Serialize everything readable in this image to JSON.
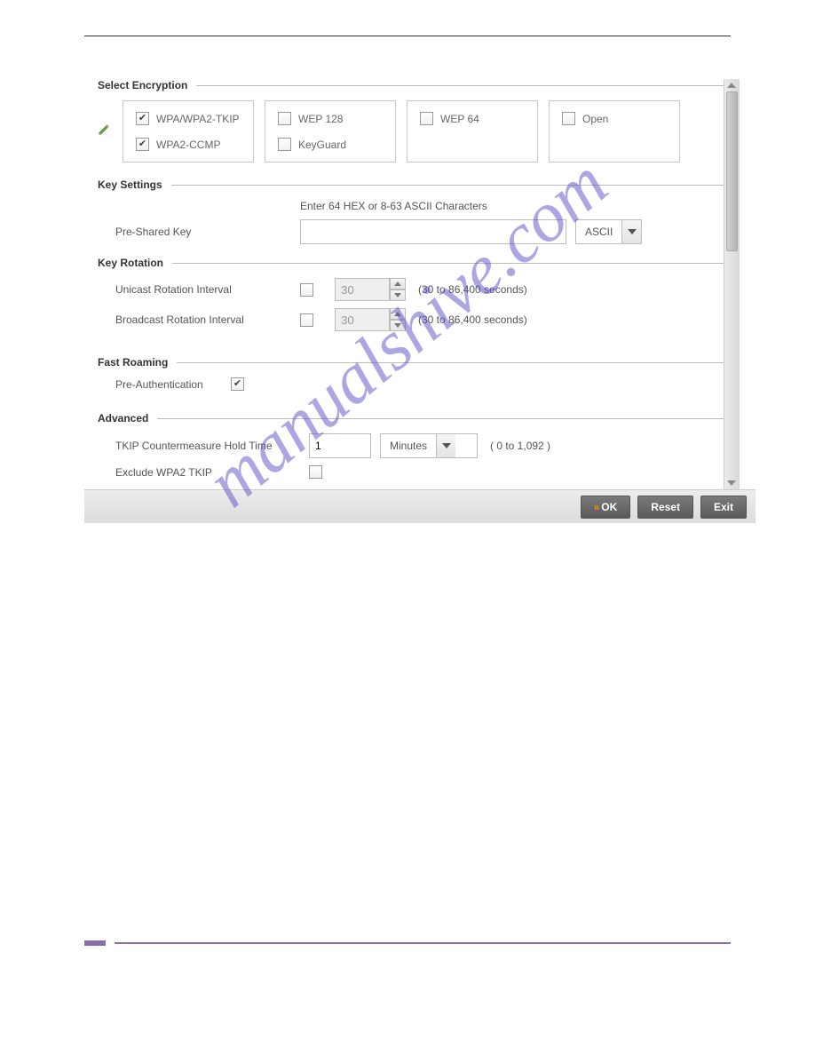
{
  "sections": {
    "encryption": {
      "title": "Select Encryption"
    },
    "keySettings": {
      "title": "Key Settings"
    },
    "keyRotation": {
      "title": "Key Rotation"
    },
    "fastRoaming": {
      "title": "Fast Roaming"
    },
    "advanced": {
      "title": "Advanced"
    }
  },
  "encryption": {
    "options": {
      "wpa_tkip": {
        "label": "WPA/WPA2-TKIP",
        "checked": true
      },
      "wpa2_ccmp": {
        "label": "WPA2-CCMP",
        "checked": true
      },
      "wep128": {
        "label": "WEP 128",
        "checked": false
      },
      "keyguard": {
        "label": "KeyGuard",
        "checked": false
      },
      "wep64": {
        "label": "WEP 64",
        "checked": false
      },
      "open": {
        "label": "Open",
        "checked": false
      }
    }
  },
  "keySettings": {
    "hint": "Enter 64 HEX or 8-63 ASCII Characters",
    "psk_label": "Pre-Shared Key",
    "psk_value": "",
    "format_selected": "ASCII"
  },
  "keyRotation": {
    "unicast": {
      "label": "Unicast Rotation Interval",
      "enabled": false,
      "value": "30",
      "hint": "(30 to 86,400 seconds)"
    },
    "broadcast": {
      "label": "Broadcast Rotation Interval",
      "enabled": false,
      "value": "30",
      "hint": "(30 to 86,400 seconds)"
    }
  },
  "fastRoaming": {
    "preauth": {
      "label": "Pre-Authentication",
      "checked": true
    }
  },
  "advanced": {
    "tkip_hold": {
      "label": "TKIP Countermeasure Hold Time",
      "value": "1",
      "unit": "Minutes",
      "hint": "( 0 to 1,092 )"
    },
    "exclude_wpa2_tkip": {
      "label": "Exclude WPA2 TKIP",
      "checked": false
    }
  },
  "buttons": {
    "ok": "OK",
    "reset": "Reset",
    "exit": "Exit"
  },
  "watermark": "manualshive.com"
}
